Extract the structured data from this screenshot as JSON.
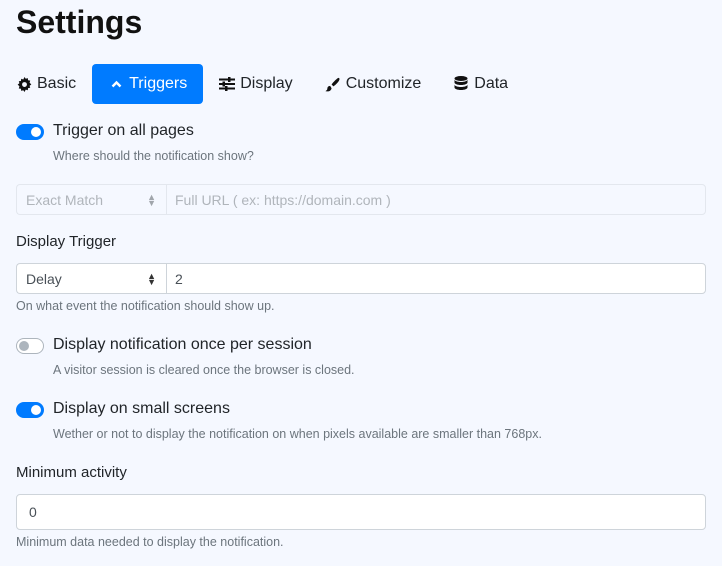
{
  "page": {
    "title": "Settings"
  },
  "tabs": [
    {
      "label": "Basic",
      "icon": "gear-icon",
      "active": false
    },
    {
      "label": "Triggers",
      "icon": "chevron-up-icon",
      "active": true
    },
    {
      "label": "Display",
      "icon": "sliders-icon",
      "active": false
    },
    {
      "label": "Customize",
      "icon": "paintbrush-icon",
      "active": false
    },
    {
      "label": "Data",
      "icon": "database-icon",
      "active": false
    }
  ],
  "trigger_all_pages": {
    "label": "Trigger on all pages",
    "enabled": true,
    "help": "Where should the notification show?"
  },
  "url_match": {
    "select_value": "Exact Match",
    "input_placeholder": "Full URL ( ex: https://domain.com )",
    "disabled": true
  },
  "display_trigger": {
    "label": "Display Trigger",
    "select_value": "Delay",
    "input_value": "2",
    "help": "On what event the notification should show up."
  },
  "once_per_session": {
    "label": "Display notification once per session",
    "enabled": false,
    "help": "A visitor session is cleared once the browser is closed."
  },
  "small_screens": {
    "label": "Display on small screens",
    "enabled": true,
    "help": "Wether or not to display the notification on when pixels available are smaller than 768px."
  },
  "minimum_activity": {
    "label": "Minimum activity",
    "value": "0",
    "help": "Minimum data needed to display the notification."
  },
  "colors": {
    "accent": "#007bff",
    "background": "#f5f8ff",
    "toggle_off": "#adb5bd",
    "help_text": "#6c757d"
  }
}
